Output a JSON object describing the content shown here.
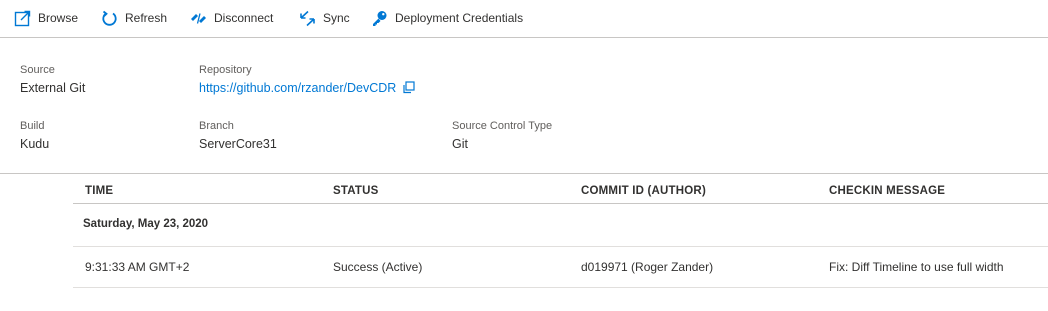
{
  "toolbar": {
    "browse_label": "Browse",
    "refresh_label": "Refresh",
    "disconnect_label": "Disconnect",
    "sync_label": "Sync",
    "credentials_label": "Deployment Credentials"
  },
  "properties": {
    "source": {
      "label": "Source",
      "value": "External Git"
    },
    "repository": {
      "label": "Repository",
      "value": "https://github.com/rzander/DevCDR"
    },
    "build": {
      "label": "Build",
      "value": "Kudu"
    },
    "branch": {
      "label": "Branch",
      "value": "ServerCore31"
    },
    "source_control_type": {
      "label": "Source Control Type",
      "value": "Git"
    }
  },
  "grid": {
    "columns": [
      "TIME",
      "STATUS",
      "COMMIT ID (AUTHOR)",
      "CHECKIN MESSAGE"
    ],
    "groups": [
      {
        "date": "Saturday, May 23, 2020",
        "rows": [
          {
            "time": "9:31:33 AM GMT+2",
            "status": "Success (Active)",
            "commit": "d019971 (Roger Zander)",
            "message": "Fix: Diff Timeline to use full width"
          }
        ]
      }
    ]
  },
  "icons": {
    "browse": "external-link-icon",
    "refresh": "refresh-icon",
    "disconnect": "disconnect-icon",
    "sync": "sync-icon",
    "credentials": "key-icon",
    "copy": "copy-icon"
  },
  "colors": {
    "accent": "#0078d4",
    "text": "#323130",
    "label": "#605e5c",
    "divider": "#c8c6c4"
  }
}
